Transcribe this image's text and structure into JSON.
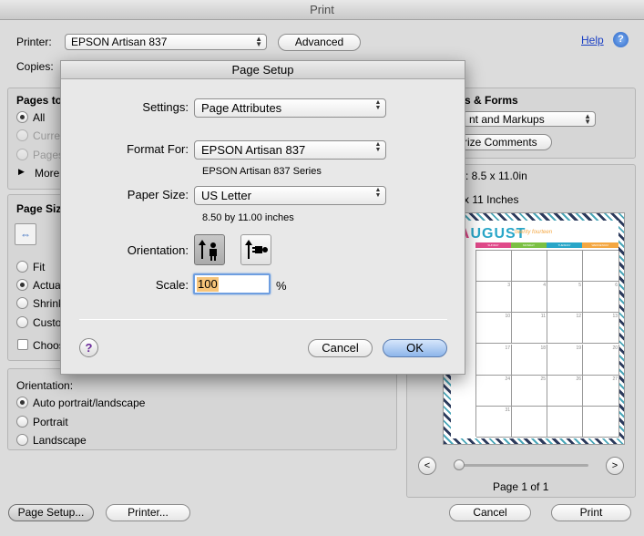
{
  "window": {
    "title": "Print"
  },
  "printer": {
    "label": "Printer:",
    "value": "EPSON Artisan 837",
    "advanced_label": "Advanced",
    "help_label": "Help"
  },
  "copies": {
    "label": "Copies:"
  },
  "pages_to": {
    "label": "Pages to",
    "all": "All",
    "current": "Curre",
    "pages": "Pages",
    "more": "More"
  },
  "page_size": {
    "label": "Page Siz",
    "fit": "Fit",
    "actual": "Actua",
    "shrink": "Shrink",
    "custom": "Custo",
    "choose": "Choos"
  },
  "orientation": {
    "label": "Orientation:",
    "auto": "Auto portrait/landscape",
    "portrait": "Portrait",
    "landscape": "Landscape"
  },
  "comments": {
    "label": "s & Forms",
    "popup": "nt and Markups",
    "summarize": "rize Comments"
  },
  "preview": {
    "size": ": 8.5 x 11.0in",
    "size2": "x 11 Inches",
    "page_label": "Page 1 of 1",
    "prev": "<",
    "next": ">"
  },
  "calendar": {
    "month": "UGUST",
    "month_first": "A",
    "script": "twenty fourteen",
    "days": [
      "SUNDAY",
      "MONDAY",
      "TUESDAY",
      "WEDNESDAY"
    ],
    "day_colors": [
      "#e04a8a",
      "#7bc043",
      "#29a6c8",
      "#f4a742"
    ],
    "numbers": [
      [
        "",
        "",
        "",
        ""
      ],
      [
        "3",
        "4",
        "5",
        "6"
      ],
      [
        "10",
        "11",
        "12",
        "13"
      ],
      [
        "17",
        "18",
        "19",
        "20"
      ],
      [
        "24",
        "25",
        "26",
        "27"
      ],
      [
        "31",
        "",
        "",
        ""
      ]
    ]
  },
  "buttons": {
    "page_setup": "Page Setup...",
    "printer": "Printer...",
    "cancel": "Cancel",
    "print": "Print"
  },
  "sheet": {
    "title": "Page Setup",
    "settings_label": "Settings:",
    "settings_value": "Page Attributes",
    "format_label": "Format For:",
    "format_value": "EPSON Artisan 837",
    "format_sub": "EPSON Artisan 837 Series",
    "paper_label": "Paper Size:",
    "paper_value": "US Letter",
    "paper_sub": "8.50 by 11.00 inches",
    "orientation_label": "Orientation:",
    "scale_label": "Scale:",
    "scale_value": "100",
    "scale_unit": "%",
    "help": "?",
    "cancel": "Cancel",
    "ok": "OK"
  }
}
